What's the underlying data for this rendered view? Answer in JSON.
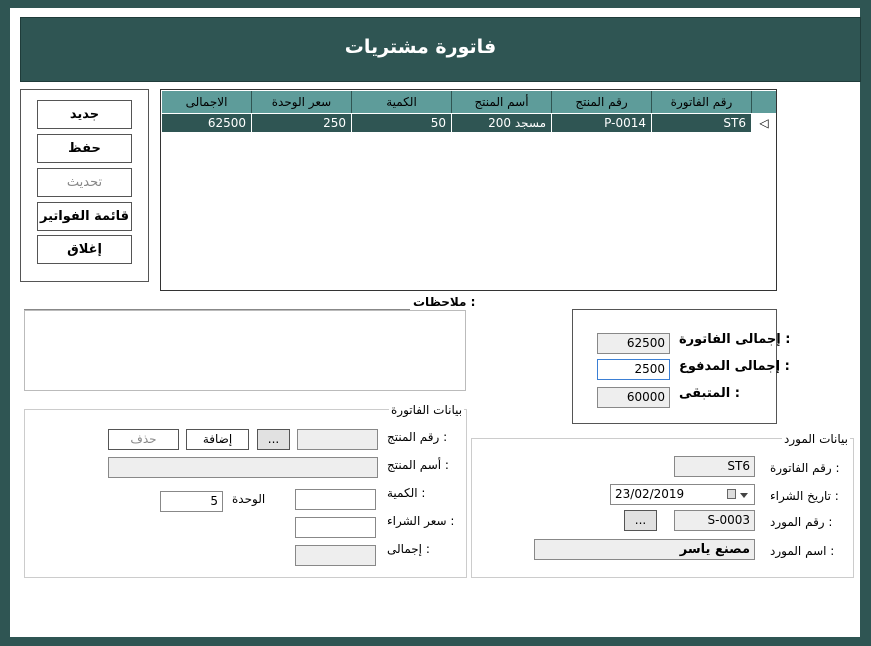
{
  "window": {
    "title": "فاتورة مشتريات"
  },
  "actions": {
    "new": "جديد",
    "save": "حفظ",
    "update": "تحديث",
    "invoice_list": "قائمة الفواتير",
    "close": "إغلاق"
  },
  "grid": {
    "columns": [
      "رقم الفاتورة",
      "رقم المنتج",
      "أسم المنتج",
      "الكمية",
      "سعر الوحدة",
      "الاجمالى"
    ],
    "rows": [
      {
        "invoice_no": "ST6",
        "product_no": "P-0014",
        "product_name": "مسجد 200",
        "qty": "50",
        "unit_price": "250",
        "total": "62500"
      }
    ],
    "row_indicator": "◁"
  },
  "notes": {
    "label": "ملاحظات :",
    "value": ""
  },
  "totals": {
    "invoice_total_label": "إجمالى الفاتورة :",
    "invoice_total_value": "62500",
    "paid_total_label": "إجمالى المدفوع :",
    "paid_total_value": "2500",
    "remaining_label": "المتبقى :",
    "remaining_value": "60000"
  },
  "invoice_data": {
    "title": "بيانات الفاتورة",
    "product_no_label": "رقم المنتج :",
    "product_no_value": "",
    "browse_label": "...",
    "add_label": "إضافة",
    "delete_label": "حذف",
    "product_name_label": "أسم المنتج :",
    "product_name_value": "",
    "qty_label": "الكمية :",
    "qty_value": "",
    "unit_label": "الوحدة",
    "unit_value": "5",
    "purchase_price_label": "سعر الشراء :",
    "purchase_price_value": "",
    "total_label": "إجمالى :",
    "total_value": ""
  },
  "supplier_data": {
    "title": "بيانات المورد",
    "invoice_no_label": "رقم الفاتورة :",
    "invoice_no_value": "ST6",
    "purchase_date_label": "تاريخ الشراء :",
    "purchase_date_value": "23/02/2019",
    "supplier_no_label": "رقم المورد :",
    "supplier_no_value": "S-0003",
    "browse_label": "...",
    "supplier_name_label": "اسم المورد :",
    "supplier_name_value": "مصنع ياسر"
  }
}
